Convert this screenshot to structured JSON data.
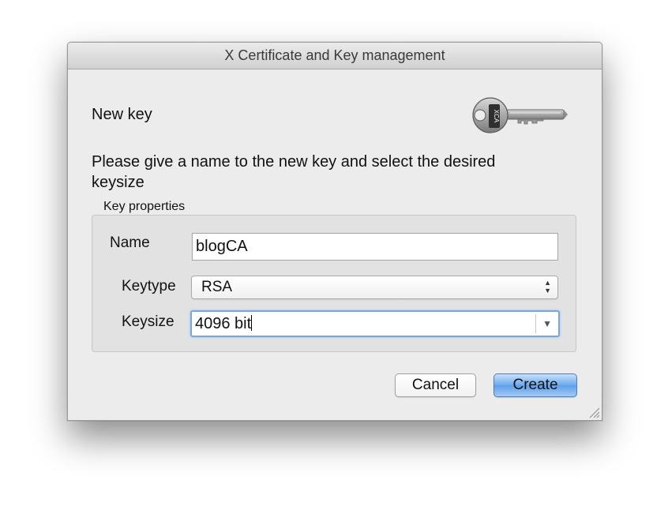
{
  "window": {
    "title": "X Certificate and Key management"
  },
  "page": {
    "title": "New key",
    "instruction": "Please give a name to the new key and select the desired keysize",
    "logo_icon": "key-icon"
  },
  "group": {
    "label": "Key properties",
    "name": {
      "label": "Name",
      "value": "blogCA"
    },
    "keytype": {
      "label": "Keytype",
      "value": "RSA"
    },
    "keysize": {
      "label": "Keysize",
      "value": "4096 bit"
    }
  },
  "buttons": {
    "cancel": "Cancel",
    "create": "Create"
  },
  "colors": {
    "accent": "#5d9fe9",
    "focus_ring": "#78a7e0",
    "window_bg": "#ececec"
  }
}
